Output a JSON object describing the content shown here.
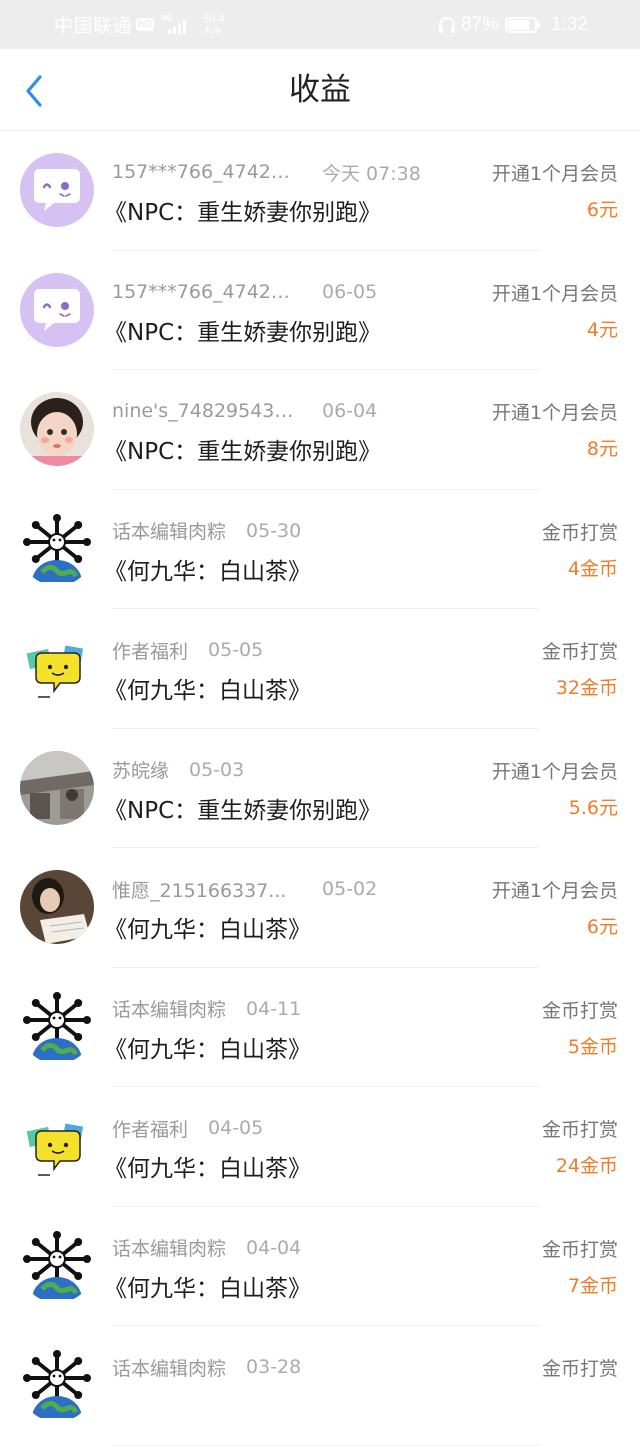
{
  "status_bar": {
    "carrier": "中国联通",
    "hd": "HD",
    "network": "4G",
    "speed_value": "30.4",
    "speed_unit": "K/s",
    "battery": "87%",
    "battery_level": 0.87,
    "time": "1:32"
  },
  "header": {
    "title": "收益"
  },
  "items": [
    {
      "user": "157***766_47427...",
      "date": "今天 07:38",
      "title": "《NPC：重生娇妻你别跑》",
      "type": "开通1个月会员",
      "amount": "6元",
      "avatar": "chat-bubble"
    },
    {
      "user": "157***766_47427...",
      "date": "06-05",
      "title": "《NPC：重生娇妻你别跑》",
      "type": "开通1个月会员",
      "amount": "4元",
      "avatar": "chat-bubble"
    },
    {
      "user": "nine's_748295438...",
      "date": "06-04",
      "title": "《NPC：重生娇妻你别跑》",
      "type": "开通1个月会员",
      "amount": "8元",
      "avatar": "child-photo"
    },
    {
      "user": "话本编辑肉粽",
      "date": "05-30",
      "title": "《何九华：白山茶》",
      "type": "金币打赏",
      "amount": "4金币",
      "avatar": "globe-bones"
    },
    {
      "user": "作者福利",
      "date": "05-05",
      "title": "《何九华：白山茶》",
      "type": "金币打赏",
      "amount": "32金币",
      "avatar": "yellow-chat"
    },
    {
      "user": "苏皖缘",
      "date": "05-03",
      "title": "《NPC：重生娇妻你别跑》",
      "type": "开通1个月会员",
      "amount": "5.6元",
      "avatar": "street-photo"
    },
    {
      "user": "惟愿_215166337...",
      "date": "05-02",
      "title": "《何九华：白山茶》",
      "type": "开通1个月会员",
      "amount": "6元",
      "avatar": "reading-photo"
    },
    {
      "user": "话本编辑肉粽",
      "date": "04-11",
      "title": "《何九华：白山茶》",
      "type": "金币打赏",
      "amount": "5金币",
      "avatar": "globe-bones"
    },
    {
      "user": "作者福利",
      "date": "04-05",
      "title": "《何九华：白山茶》",
      "type": "金币打赏",
      "amount": "24金币",
      "avatar": "yellow-chat"
    },
    {
      "user": "话本编辑肉粽",
      "date": "04-04",
      "title": "《何九华：白山茶》",
      "type": "金币打赏",
      "amount": "7金币",
      "avatar": "globe-bones"
    },
    {
      "user": "话本编辑肉粽",
      "date": "03-28",
      "title": "",
      "type": "金币打赏",
      "amount": "",
      "avatar": "globe-bones"
    }
  ],
  "colors": {
    "accent_blue": "#2f8ee8",
    "amount_orange": "#f07c2a",
    "status_bar_bg": "#ededed"
  }
}
